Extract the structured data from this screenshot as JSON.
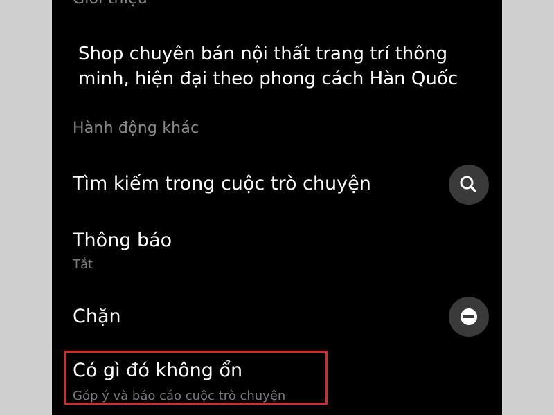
{
  "intro": {
    "header": "Giới thiệu",
    "text": "Shop chuyên bán nội thất trang trí thông minh, hiện đại theo phong cách Hàn Quốc"
  },
  "actions": {
    "header": "Hành động khác",
    "search": {
      "title": "Tìm kiếm trong cuộc trò chuyện",
      "icon": "search-icon"
    },
    "notifications": {
      "title": "Thông báo",
      "subtitle": "Tắt"
    },
    "block": {
      "title": "Chặn",
      "icon": "block-icon"
    },
    "report": {
      "title": "Có gì đó không ổn",
      "subtitle": "Góp ý và báo cáo cuộc trò chuyện"
    }
  },
  "colors": {
    "background": "#000000",
    "text_primary": "#ffffff",
    "text_secondary": "#8a8a8a",
    "icon_button_bg": "#3a3a3a",
    "highlight": "#d42a2a"
  }
}
